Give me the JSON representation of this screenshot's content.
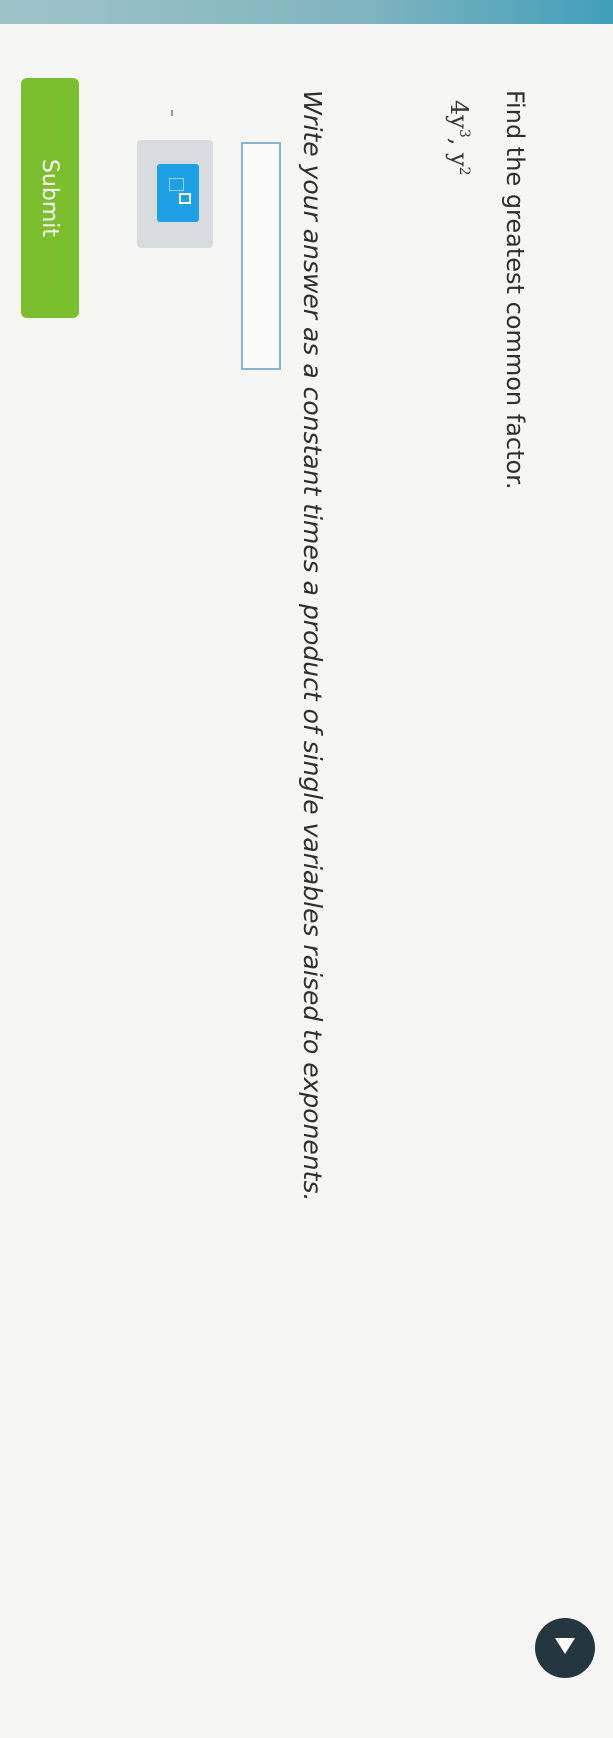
{
  "question": {
    "prompt": "Find the greatest common factor.",
    "expression": {
      "term1_coeff_var": "4y",
      "term1_exp": "3",
      "separator": ", ",
      "term2_var": "y",
      "term2_exp": "2"
    },
    "instruction": "Write your answer as a constant times a product of single variables raised to exponents."
  },
  "answer": {
    "value": ""
  },
  "editor": {
    "buttons": [
      {
        "icon": "exponent-icon"
      }
    ]
  },
  "actions": {
    "submit_label": "Submit"
  },
  "nav": {
    "icon": "play-arrow-icon"
  },
  "colors": {
    "submit_bg": "#7bbe2e",
    "exponent_button_bg": "#1ea0e6",
    "input_border": "#8ab2d2",
    "nav_circle_bg": "#24363f"
  }
}
